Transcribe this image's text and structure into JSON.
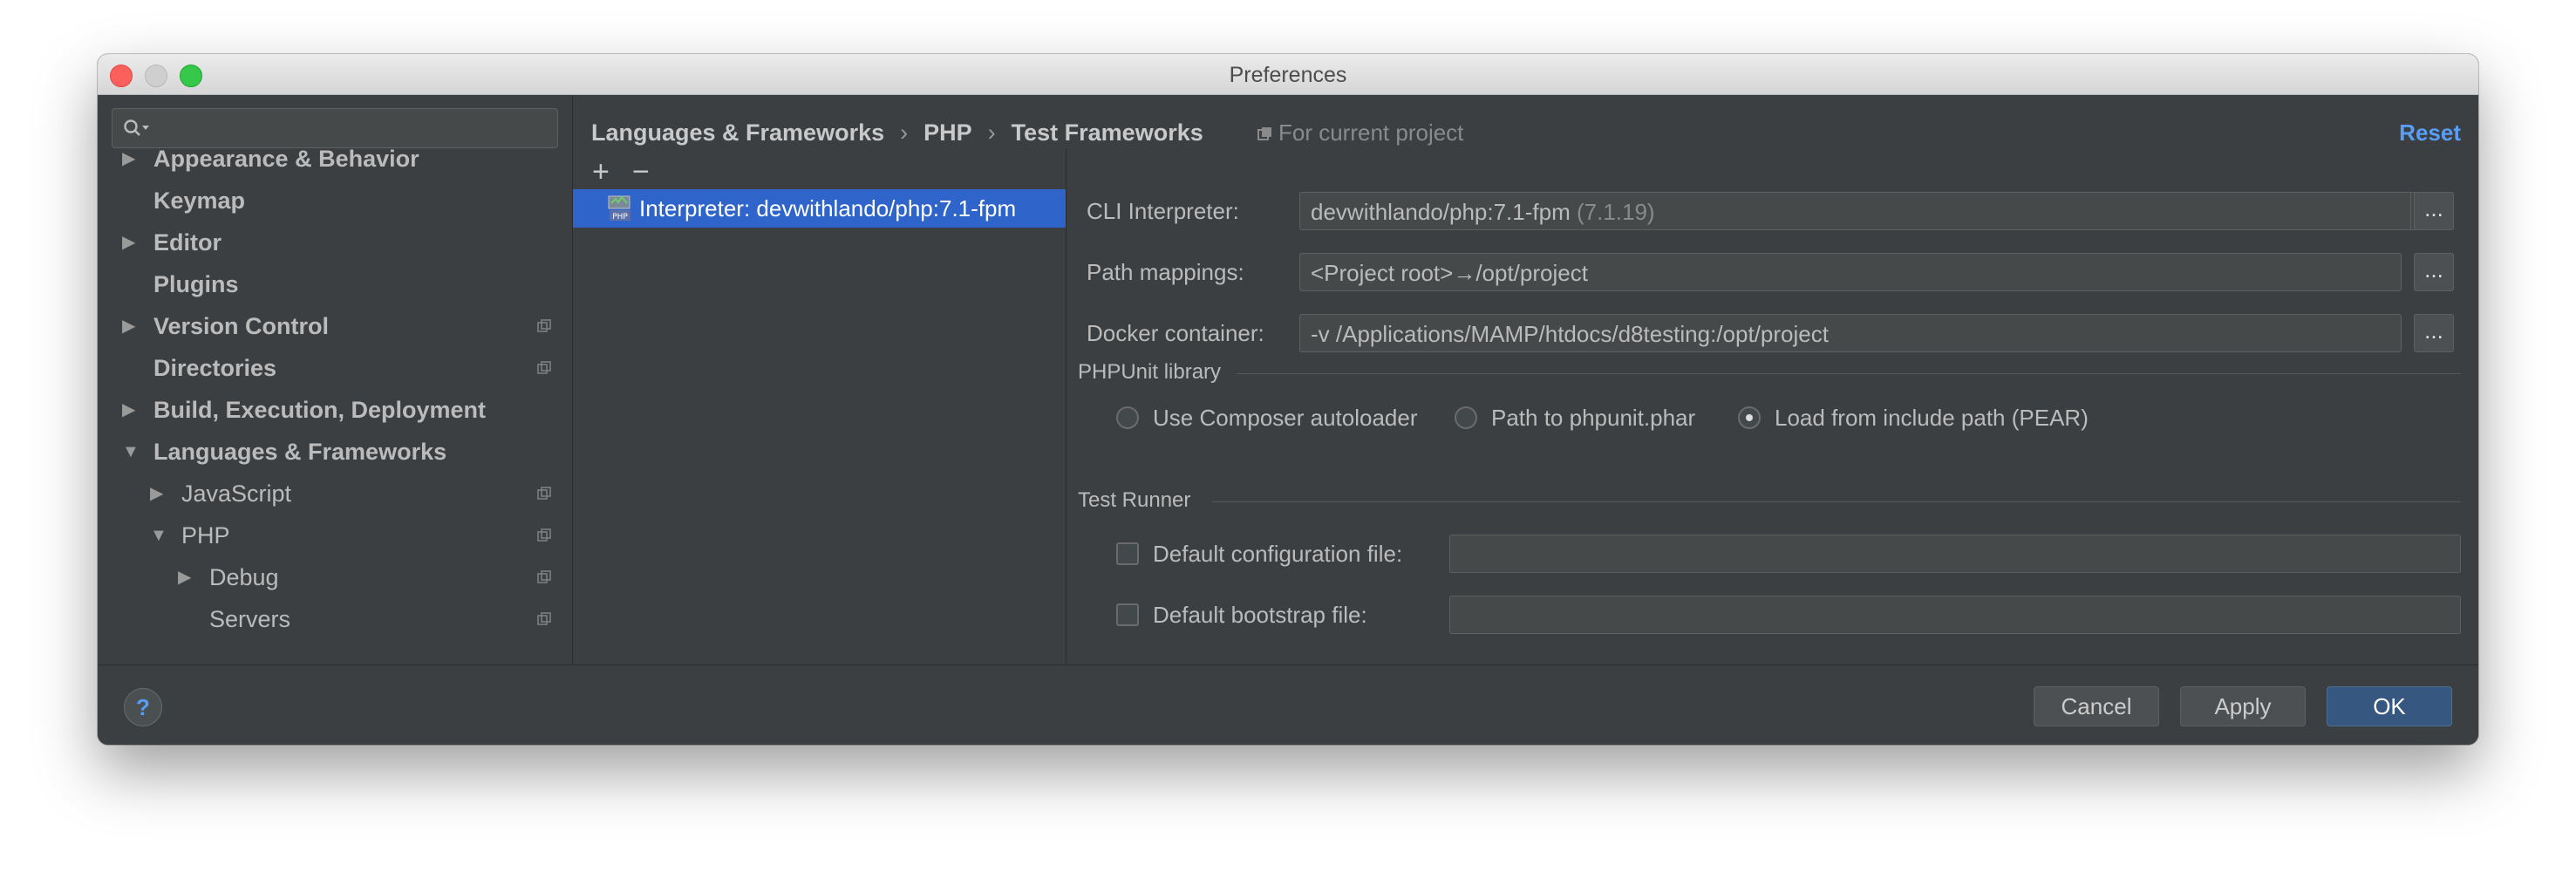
{
  "window": {
    "title": "Preferences"
  },
  "search": {
    "placeholder": ""
  },
  "sidebar": {
    "items": [
      {
        "label": "Appearance & Behavior",
        "bold": true,
        "expandable": true,
        "expanded": false
      },
      {
        "label": "Keymap",
        "bold": true,
        "expandable": false
      },
      {
        "label": "Editor",
        "bold": true,
        "expandable": true,
        "expanded": false
      },
      {
        "label": "Plugins",
        "bold": true,
        "expandable": false
      },
      {
        "label": "Version Control",
        "bold": true,
        "expandable": true,
        "expanded": false,
        "project_icon": true
      },
      {
        "label": "Directories",
        "bold": true,
        "expandable": false,
        "project_icon": true
      },
      {
        "label": "Build, Execution, Deployment",
        "bold": true,
        "expandable": true,
        "expanded": false
      },
      {
        "label": "Languages & Frameworks",
        "bold": true,
        "expandable": true,
        "expanded": true
      },
      {
        "label": "JavaScript",
        "bold": false,
        "expandable": true,
        "expanded": false,
        "project_icon": true
      },
      {
        "label": "PHP",
        "bold": false,
        "expandable": true,
        "expanded": true,
        "project_icon": true
      },
      {
        "label": "Debug",
        "bold": false,
        "expandable": true,
        "expanded": false,
        "project_icon": true
      },
      {
        "label": "Servers",
        "bold": false,
        "expandable": false,
        "project_icon": true
      }
    ]
  },
  "breadcrumb": {
    "items": [
      "Languages & Frameworks",
      "PHP",
      "Test Frameworks"
    ],
    "separator": "›",
    "scope": "For current project",
    "reset": "Reset"
  },
  "interpreters": {
    "add": "+",
    "remove": "−",
    "items": [
      "Interpreter: devwithlando/php:7.1-fpm"
    ]
  },
  "form": {
    "cli_interpreter": {
      "label": "CLI Interpreter:",
      "value": "devwithlando/php:7.1-fpm",
      "version": "(7.1.19)"
    },
    "path_mappings": {
      "label": "Path mappings:",
      "value": "<Project root>→/opt/project"
    },
    "docker_container": {
      "label": "Docker container:",
      "value": "-v /Applications/MAMP/htdocs/d8testing:/opt/project"
    },
    "browse_label": "..."
  },
  "phpunit": {
    "title": "PHPUnit library",
    "options": [
      {
        "label": "Use Composer autoloader",
        "checked": false
      },
      {
        "label": "Path to phpunit.phar",
        "checked": false
      },
      {
        "label": "Load from include path (PEAR)",
        "checked": true
      }
    ]
  },
  "test_runner": {
    "title": "Test Runner",
    "default_config": {
      "label": "Default configuration file:",
      "checked": false,
      "value": ""
    },
    "default_bootstrap": {
      "label": "Default bootstrap file:",
      "checked": false,
      "value": ""
    }
  },
  "buttons": {
    "help": "?",
    "cancel": "Cancel",
    "apply": "Apply",
    "ok": "OK"
  },
  "colors": {
    "accent": "#589df6",
    "selection": "#2f65ca",
    "background": "#3c3f41",
    "default_button": "#365880"
  }
}
